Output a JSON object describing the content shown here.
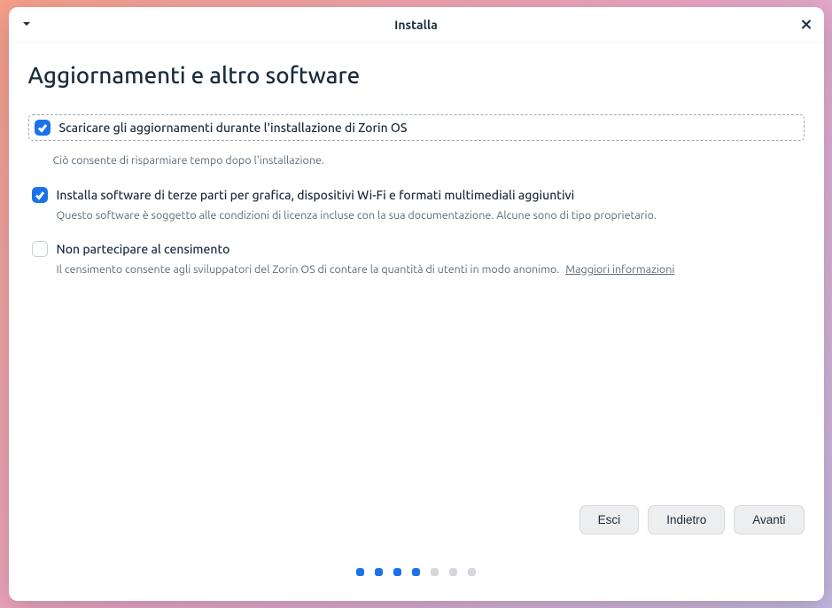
{
  "titlebar": {
    "title": "Installa"
  },
  "heading": "Aggiornamenti e altro software",
  "options": [
    {
      "checked": true,
      "focused": true,
      "label": "Scaricare gli aggiornamenti durante l'installazione di Zorin OS",
      "desc": "Ciò consente di risparmiare tempo dopo l'installazione."
    },
    {
      "checked": true,
      "focused": false,
      "label": "Installa software di terze parti per grafica, dispositivi Wi-Fi e formati multimediali aggiuntivi",
      "desc": "Questo software è soggetto alle condizioni di licenza incluse con la sua documentazione. Alcune sono di tipo proprietario."
    },
    {
      "checked": false,
      "focused": false,
      "label": "Non partecipare al censimento",
      "desc": "Il censimento consente agli sviluppatori del Zorin OS di contare la quantità di utenti in modo anonimo.",
      "link": "Maggiori informazioni"
    }
  ],
  "buttons": {
    "quit": "Esci",
    "back": "Indietro",
    "next": "Avanti"
  },
  "progress": {
    "total": 7,
    "active": 4
  }
}
